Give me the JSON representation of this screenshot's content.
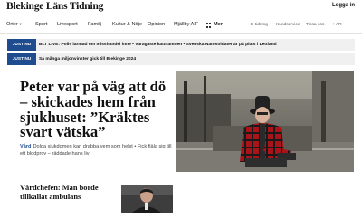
{
  "header": {
    "logo_text": "Blekinge Läns Tidning",
    "login_label": "Logga in"
  },
  "nav": {
    "items": [
      {
        "label": "Orter"
      },
      {
        "label": "Sport"
      },
      {
        "label": "Livesport"
      },
      {
        "label": "Familj"
      },
      {
        "label": "Kultur & Nöje"
      },
      {
        "label": "Opinion"
      },
      {
        "label": "Mjällby AIF"
      },
      {
        "label": "Mer"
      }
    ],
    "right_items": [
      {
        "label": "E-tidning"
      },
      {
        "label": "Kundservice"
      },
      {
        "label": "Tipsa oss"
      },
      {
        "label": "+ AR"
      }
    ]
  },
  "breaking": [
    {
      "badge": "JUST NU",
      "text": "BLT LIVE: Polis larmad om misshandel inne • Varägaste kattnamnen • Svenska Natosoldater är på plats i Lettland"
    },
    {
      "badge": "JUST NU",
      "text": "Så många miljonvinster gick till Blekinge 2024"
    }
  ],
  "main_story": {
    "headline": "Peter var på väg att dö – skickades hem från sjukhuset: ”Kräktes svart vätska”",
    "kicker": "Vård",
    "lead": "Dolda sjukdomen kan drabba vem som helst • Fick fjäla sig till ett blodprov – räddade hans liv"
  },
  "second_story": {
    "headline": "Vårdchefen: Man borde tillkallat ambulans"
  },
  "colors": {
    "accent": "#1f4b8f",
    "breaking_bg": "#f0f0f0"
  }
}
